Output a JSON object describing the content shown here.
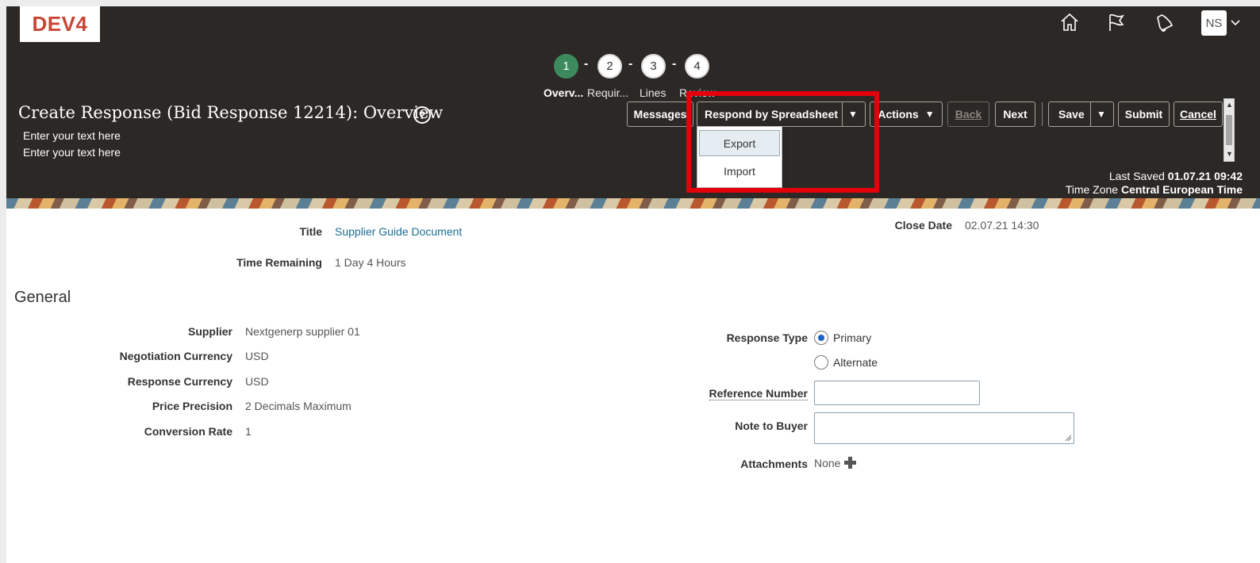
{
  "app": {
    "env_label": "DEV4",
    "user_initials": "NS"
  },
  "header_icons": [
    "home-icon",
    "flag-icon",
    "bell-icon",
    "chevron-down-icon"
  ],
  "train": {
    "steps": [
      {
        "number": "1",
        "label": "Overv...",
        "active": true
      },
      {
        "number": "2",
        "label": "Requir...",
        "active": false
      },
      {
        "number": "3",
        "label": "Lines",
        "active": false
      },
      {
        "number": "4",
        "label": "Review",
        "active": false
      }
    ],
    "separator": "-"
  },
  "page": {
    "title": "Create Response (Bid Response 12214): Overview",
    "help_symbol": "?",
    "subtext_1": "Enter your text here",
    "subtext_2": "Enter your text here"
  },
  "toolbar": {
    "messages": "Messages",
    "respond_by_spreadsheet": "Respond by Spreadsheet",
    "actions": "Actions",
    "back": "Back",
    "next": "Next",
    "save": "Save",
    "submit": "Submit",
    "cancel": "Cancel",
    "dropdown_symbol": "▼"
  },
  "spreadsheet_menu": {
    "items": [
      "Export",
      "Import"
    ],
    "hovered": "Export"
  },
  "save_status": {
    "last_saved_label": "Last Saved",
    "last_saved_value": "01.07.21 09:42",
    "timezone_label": "Time Zone",
    "timezone_value": "Central European Time"
  },
  "overview": {
    "title_label": "Title",
    "title_value": "Supplier Guide Document",
    "time_remaining_label": "Time Remaining",
    "time_remaining_value": "1 Day 4 Hours",
    "close_date_label": "Close Date",
    "close_date_value": "02.07.21 14:30"
  },
  "general": {
    "heading": "General",
    "supplier_label": "Supplier",
    "supplier_value": "Nextgenerp supplier 01",
    "negotiation_currency_label": "Negotiation Currency",
    "negotiation_currency_value": "USD",
    "response_currency_label": "Response Currency",
    "response_currency_value": "USD",
    "price_precision_label": "Price Precision",
    "price_precision_value": "2 Decimals Maximum",
    "conversion_rate_label": "Conversion Rate",
    "conversion_rate_value": "1",
    "response_type_label": "Response Type",
    "response_type_options": [
      "Primary",
      "Alternate"
    ],
    "response_type_selected": "Primary",
    "reference_number_label": "Reference Number",
    "reference_number_value": "",
    "note_to_buyer_label": "Note to Buyer",
    "note_to_buyer_value": "",
    "attachments_label": "Attachments",
    "attachments_value": "None"
  },
  "colors": {
    "header_bg": "#2c2825",
    "step_active": "#3e8a5f",
    "logo_text": "#c74634",
    "link": "#1a6d94",
    "highlight_box": "#e3000b"
  }
}
